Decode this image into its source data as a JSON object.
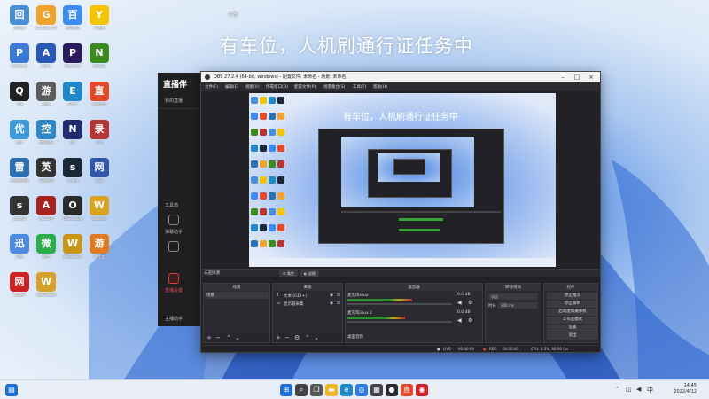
{
  "overlay": {
    "title": "有车位，人机刷通行证任务中",
    "subtitle": "扩散"
  },
  "desktop_icons": [
    {
      "label": "回收站",
      "icon": "recycle-bin-icon",
      "color": "#4a8fd6"
    },
    {
      "label": "Godotte GO",
      "icon": "app-go-icon",
      "color": "#f2a32b"
    },
    {
      "label": "百度网盘",
      "icon": "cloud-drive-icon",
      "color": "#3f8cf0"
    },
    {
      "label": "YY直播",
      "icon": "yy-icon",
      "color": "#f5c400"
    },
    {
      "label": "PotPlayer",
      "icon": "player-icon",
      "color": "#3a7ad6"
    },
    {
      "label": "Aloha",
      "icon": "browser-icon",
      "color": "#2a58b8"
    },
    {
      "label": "Premiere",
      "icon": "premiere-icon",
      "color": "#2a1a5e"
    },
    {
      "label": "NVIDIA",
      "icon": "nvidia-icon",
      "color": "#3d8a1f"
    },
    {
      "label": "QQ",
      "icon": "qq-icon",
      "color": "#222"
    },
    {
      "label": "游戏",
      "icon": "game-icon",
      "color": "#5c5c5c"
    },
    {
      "label": "Edge",
      "icon": "edge-icon",
      "color": "#1e88c8"
    },
    {
      "label": "直播伴侣",
      "icon": "live-icon",
      "color": "#e34a2a"
    },
    {
      "label": "优化",
      "icon": "tool-icon",
      "color": "#3c9ade"
    },
    {
      "label": "控制面板",
      "icon": "panel-icon",
      "color": "#2e88c7"
    },
    {
      "label": "NX",
      "icon": "nx-icon",
      "color": "#1d2d6d"
    },
    {
      "label": "录屏",
      "icon": "record-icon",
      "color": "#b83333"
    },
    {
      "label": "雷神加速器",
      "icon": "thunder-icon",
      "color": "#2d6fb3"
    },
    {
      "label": "英雄联盟",
      "icon": "lol-icon",
      "color": "#333"
    },
    {
      "label": "steam",
      "icon": "steam-icon",
      "color": "#1b2838"
    },
    {
      "label": "网易",
      "icon": "netease-icon",
      "color": "#3355aa"
    },
    {
      "label": "steam2",
      "icon": "steam2-icon",
      "color": "#333"
    },
    {
      "label": "ACCEPT",
      "icon": "accept-icon",
      "color": "#a82222"
    },
    {
      "label": "OBS Studio",
      "icon": "obs-icon",
      "color": "#2a2a2a"
    },
    {
      "label": "WeGame",
      "icon": "wegame-icon",
      "color": "#d8a321"
    },
    {
      "label": "迅雷",
      "icon": "xunlei-icon",
      "color": "#4d8ae2"
    },
    {
      "label": "微信",
      "icon": "wechat-icon",
      "color": "#2aae4a"
    },
    {
      "label": "WeGame2",
      "icon": "wegame2-icon",
      "color": "#c9961c"
    },
    {
      "label": "游戏盒",
      "icon": "box-icon",
      "color": "#e07b22"
    },
    {
      "label": "网易云",
      "icon": "music-icon",
      "color": "#c22"
    },
    {
      "label": "WeGame版",
      "icon": "wegame3-icon",
      "color": "#d7a02a"
    }
  ],
  "live_app": {
    "logo": "直播伴",
    "items": [
      "我的直播",
      "工具箱",
      "弹幕助手",
      "直播设置"
    ],
    "footer": "主播助手"
  },
  "obs": {
    "title": "OBS 27.2.4 (64-bit, windows) - 配置文件: 未命名 - 场景: 未命名",
    "menu": [
      "文件(F)",
      "编辑(E)",
      "视图(V)",
      "停靠窗口(D)",
      "配置文件(P)",
      "场景集合(S)",
      "工具(T)",
      "帮助(H)"
    ],
    "window_controls": {
      "minimize": "–",
      "maximize": "□",
      "close": "×"
    },
    "no_source": "未选择源",
    "source_props": [
      "属性",
      "滤镜"
    ],
    "preview_title": "有车位，人机刷通行证任务中",
    "docks": {
      "scenes": {
        "title": "场景",
        "items": [
          "场景"
        ]
      },
      "sources": {
        "title": "来源",
        "items": [
          "文本 (GDI+)",
          "显示器采集"
        ]
      },
      "mixer": {
        "title": "混音器",
        "channels": [
          {
            "name": "麦克风/Aux",
            "db": "0.0 dB",
            "level": 0.62
          },
          {
            "name": "麦克风/Aux 2",
            "db": "0.0 dB",
            "level": 0.55
          }
        ],
        "footer": "桌面音频"
      },
      "transitions": {
        "title": "转场特效",
        "type": "淡出",
        "duration_label": "时长",
        "duration": "300 ms"
      },
      "controls": {
        "title": "控件",
        "buttons": [
          "停止推流",
          "停止录制",
          "启动虚拟摄像机",
          "工作室模式",
          "设置",
          "退出"
        ]
      }
    },
    "status": {
      "live_label": "LIVE:",
      "live_time": "00:00:00",
      "rec_label": "REC:",
      "rec_time": "00:00:00",
      "cpu": "CPU: 0.3%, 60.00 fps"
    }
  },
  "taskbar": {
    "icons": [
      "start-icon",
      "search-icon",
      "task-view-icon",
      "explorer-icon",
      "edge-icon",
      "browser-icon",
      "store-icon",
      "obs-icon",
      "live-icon",
      "app-icon"
    ],
    "time": "14:45",
    "date": "2022/4/12"
  }
}
